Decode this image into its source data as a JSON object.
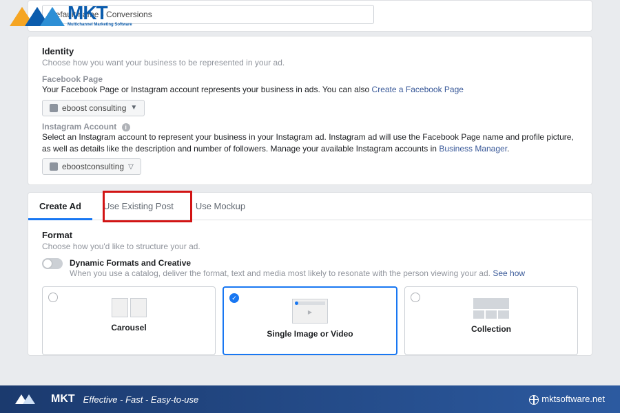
{
  "logo": {
    "brand": "MKT",
    "tagline": "Multichannel Marketing Software"
  },
  "ad_name_input": "Default name - Conversions",
  "identity": {
    "title": "Identity",
    "subtitle": "Choose how you want your business to be represented in your ad.",
    "fb_page": {
      "label": "Facebook Page",
      "desc_prefix": "Your Facebook Page or Instagram account represents your business in ads. You can also ",
      "link": "Create a Facebook Page",
      "selected": "eboost consulting"
    },
    "ig": {
      "label": "Instagram Account",
      "desc_prefix": "Select an Instagram account to represent your business in your Instagram ad. Instagram ad will use the Facebook Page name and profile picture, as well as details like the description and number of followers. Manage your available Instagram accounts in ",
      "link": "Business Manager",
      "desc_suffix": ".",
      "selected": "eboostconsulting"
    }
  },
  "tabs": {
    "create_ad": "Create Ad",
    "use_existing": "Use Existing Post",
    "use_mockup": "Use Mockup"
  },
  "format": {
    "title": "Format",
    "subtitle": "Choose how you'd like to structure your ad.",
    "dynamic": {
      "title": "Dynamic Formats and Creative",
      "desc_prefix": "When you use a catalog, deliver the format, text and media most likely to resonate with the person viewing your ad. ",
      "link": "See how"
    },
    "options": {
      "carousel": "Carousel",
      "single": "Single Image or Video",
      "collection": "Collection"
    }
  },
  "footer": {
    "tagline": "Effective - Fast - Easy-to-use",
    "site": "mktsoftware.net"
  }
}
